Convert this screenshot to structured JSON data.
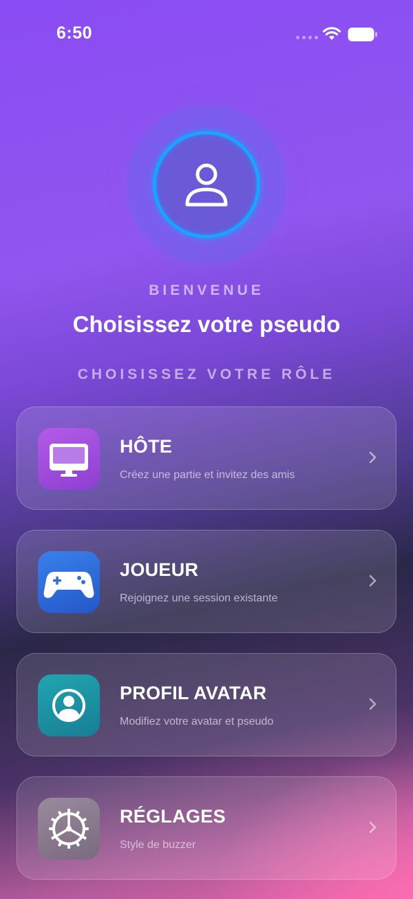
{
  "status_bar": {
    "time": "6:50"
  },
  "header": {
    "welcome": "BIENVENUE",
    "title": "Choisissez votre pseudo",
    "role_title": "CHOISISSEZ VOTRE RÔLE"
  },
  "roles": [
    {
      "name": "HÔTE",
      "description": "Créez une partie et invitez des amis",
      "icon": "monitor-icon",
      "color": "#a14fe0"
    },
    {
      "name": "JOUEUR",
      "description": "Rejoignez une session existante",
      "icon": "gamepad-icon",
      "color": "#2e6fe0"
    },
    {
      "name": "PROFIL AVATAR",
      "description": "Modifiez votre avatar et pseudo",
      "icon": "user-circle-icon",
      "color": "#1b97a6"
    },
    {
      "name": "RÉGLAGES",
      "description": "Style de buzzer",
      "icon": "gear-icon",
      "color": "#8a7a8e"
    }
  ],
  "colors": {
    "avatar_ring": "#1aa3ff",
    "background_top": "#8a4cf3",
    "background_bottom": "#e666a8"
  }
}
